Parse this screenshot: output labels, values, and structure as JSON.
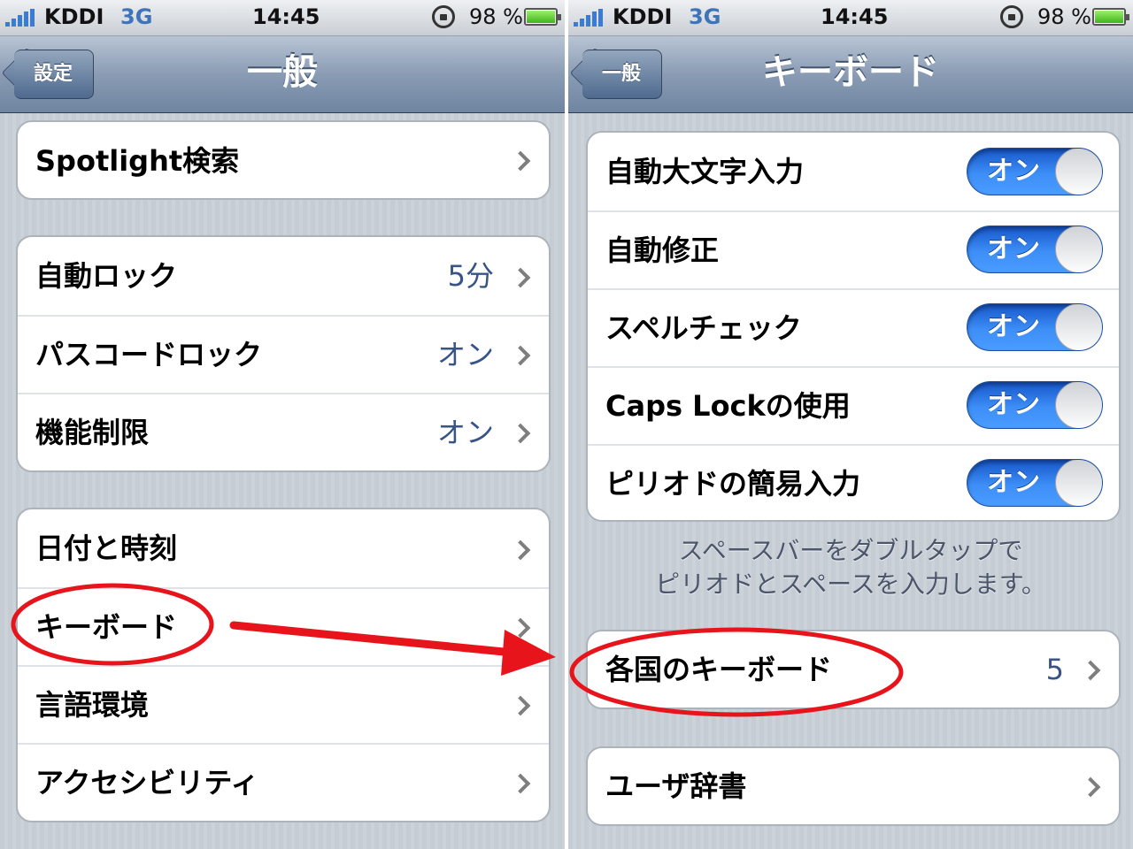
{
  "status": {
    "carrier": "KDDI",
    "network": "3G",
    "time": "14:45",
    "battery": "98 %",
    "battery_level": 0.98
  },
  "left": {
    "back_label": "設定",
    "title": "一般",
    "groups": [
      [
        {
          "label": "Spotlight検索",
          "value": ""
        }
      ],
      [
        {
          "label": "自動ロック",
          "value": "5分"
        },
        {
          "label": "パスコードロック",
          "value": "オン"
        },
        {
          "label": "機能制限",
          "value": "オン"
        }
      ],
      [
        {
          "label": "日付と時刻",
          "value": ""
        },
        {
          "label": "キーボード",
          "value": ""
        },
        {
          "label": "言語環境",
          "value": ""
        },
        {
          "label": "アクセシビリティ",
          "value": ""
        }
      ]
    ]
  },
  "right": {
    "back_label": "一般",
    "title": "キーボード",
    "toggles": [
      {
        "label": "自動大文字入力",
        "state": "オン"
      },
      {
        "label": "自動修正",
        "state": "オン"
      },
      {
        "label": "スペルチェック",
        "state": "オン"
      },
      {
        "label": "Caps Lockの使用",
        "state": "オン"
      },
      {
        "label": "ピリオドの簡易入力",
        "state": "オン"
      }
    ],
    "footnote": [
      "スペースバーをダブルタップで",
      "ピリオドとスペースを入力します。"
    ],
    "intl_keyboards": {
      "label": "各国のキーボード",
      "value": "5"
    },
    "user_dict": {
      "label": "ユーザ辞書"
    }
  },
  "colors": {
    "annotation": "#e8141b",
    "toggle_on": "#2f7ff0",
    "value_text": "#385487"
  }
}
